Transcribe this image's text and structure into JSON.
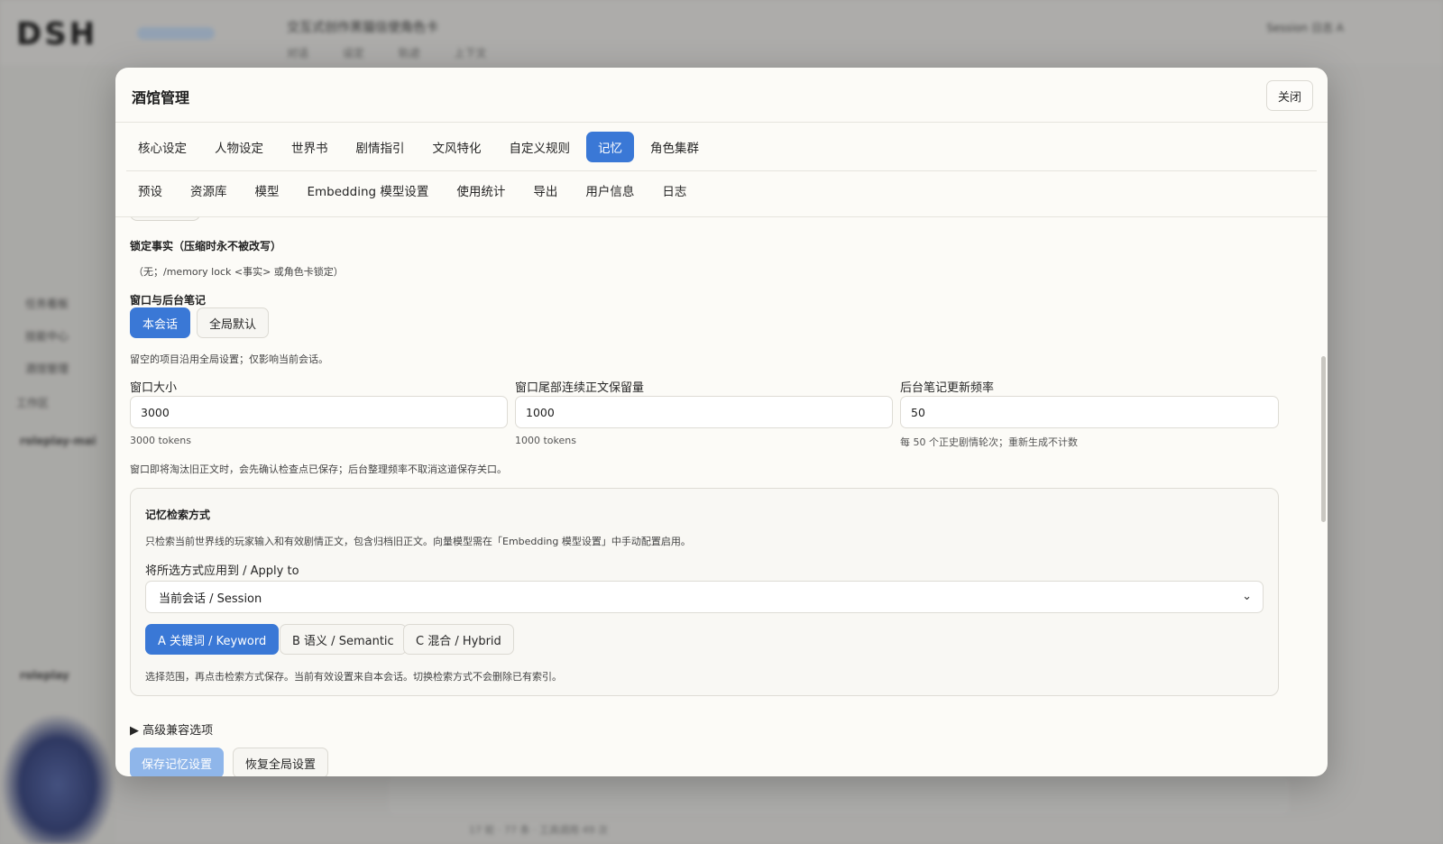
{
  "background_app": {
    "logo": "DSH",
    "title": "交互式创作黑猫信使角色卡",
    "subtabs": [
      "对话",
      "设定",
      "轨迹",
      "上下文"
    ],
    "right": "Session 日志 A",
    "side_items": [
      "任务看板",
      "技能中心",
      "酒馆管理",
      "工作区",
      "roleplay-mai",
      "roleplay"
    ],
    "status": "17 轮 · 77 条 · 工具调用 49 次"
  },
  "modal": {
    "title": "酒馆管理",
    "close_label": "关闭",
    "tabs_row1": [
      "核心设定",
      "人物设定",
      "世界书",
      "剧情指引",
      "文风特化",
      "自定义规则",
      "记忆",
      "角色集群"
    ],
    "tabs_row1_active": "记忆",
    "tabs_row2": [
      "预设",
      "资源库",
      "模型",
      "Embedding 模型设置",
      "使用统计",
      "导出",
      "用户信息",
      "日志"
    ]
  },
  "memory": {
    "locked_facts": {
      "heading": "锁定事实（压缩时永不被改写）",
      "empty_text": "（无；/memory lock <事实> 或角色卡锁定）"
    },
    "window_notes": {
      "heading": "窗口与后台笔记",
      "scope_buttons": [
        "本会话",
        "全局默认"
      ],
      "active_scope": "本会话",
      "hint": "留空的项目沿用全局设置；仅影响当前会话。",
      "fields": [
        {
          "label": "窗口大小",
          "value": "3000",
          "helper": "3000 tokens"
        },
        {
          "label": "窗口尾部连续正文保留量",
          "value": "1000",
          "helper": "1000 tokens"
        },
        {
          "label": "后台笔记更新频率",
          "value": "50",
          "helper": "每 50 个正史剧情轮次；重新生成不计数"
        }
      ],
      "footnote": "窗口即将淘汰旧正文时，会先确认检查点已保存；后台整理频率不取消这道保存关口。"
    },
    "retrieval": {
      "heading": "记忆检索方式",
      "description": "只检索当前世界线的玩家输入和有效剧情正文，包含归档旧正文。向量模型需在「Embedding 模型设置」中手动配置启用。",
      "apply_label": "将所选方式应用到 / Apply to",
      "apply_value": "当前会话 / Session",
      "methods": [
        "A 关键词 / Keyword",
        "B 语义 / Semantic",
        "C 混合 / Hybrid"
      ],
      "active_method": "A 关键词 / Keyword",
      "note": "选择范围，再点击检索方式保存。当前有效设置来自本会话。切换检索方式不会删除已有索引。"
    },
    "advanced_label": "▶ 高级兼容选项",
    "save_label": "保存记忆设置",
    "restore_label": "恢复全局设置"
  },
  "colors": {
    "accent": "#3a78d6",
    "modal_bg": "#fcfbf7",
    "border": "#dedcd5"
  }
}
